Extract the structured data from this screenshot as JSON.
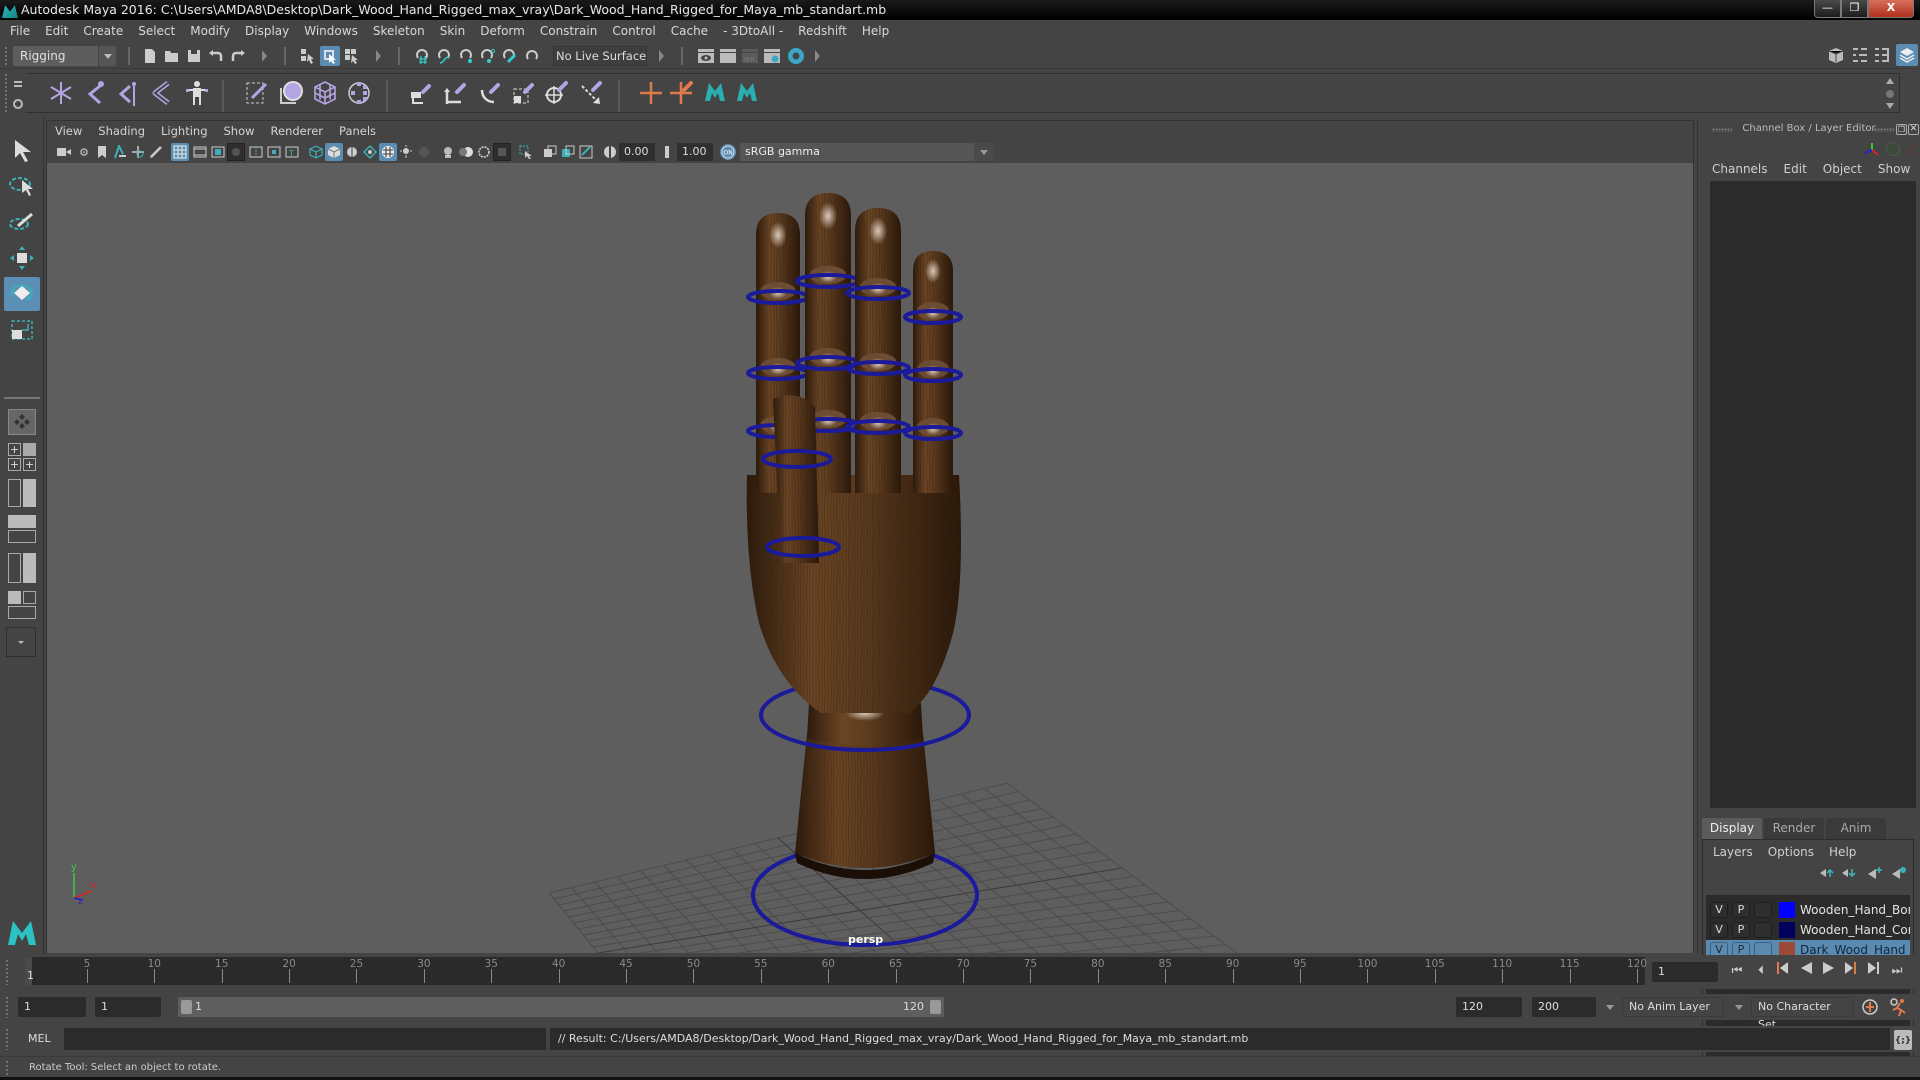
{
  "window": {
    "title": "Autodesk Maya 2016: C:\\Users\\AMDA8\\Desktop\\Dark_Wood_Hand_Rigged_max_vray\\Dark_Wood_Hand_Rigged_for_Maya_mb_standart.mb",
    "minimize": "—",
    "restore": "❐",
    "close": "X"
  },
  "menubar": [
    "File",
    "Edit",
    "Create",
    "Select",
    "Modify",
    "Display",
    "Windows",
    "Skeleton",
    "Skin",
    "Deform",
    "Constrain",
    "Control",
    "Cache",
    "- 3DtoAll -",
    "Redshift",
    "Help"
  ],
  "statusline": {
    "mode": "Rigging",
    "live_surface": "No Live Surface",
    "icons": [
      "new-scene-icon",
      "open-scene-icon",
      "save-scene-icon",
      "undo-icon",
      "redo-icon",
      "select-hierarchy-icon",
      "select-object-icon",
      "select-component-icon",
      "snap-grid-icon",
      "snap-curve-icon",
      "snap-point-icon",
      "snap-view-plane-icon",
      "snap-live-icon",
      "snap-rotate-icon",
      "render-view-icon",
      "render-current-icon",
      "ipr-render-icon",
      "render-settings-icon",
      "hypershade-icon"
    ]
  },
  "shelf": {
    "icons": [
      "create-joints-icon",
      "insert-joint-icon",
      "mirror-joint-icon",
      "ik-handle-icon",
      "humanik-icon",
      "bind-skin-icon",
      "smooth-bind-icon",
      "lattice-icon",
      "cluster-icon",
      "parent-constraint-icon",
      "point-constraint-icon",
      "orient-constraint-icon",
      "scale-constraint-icon",
      "aim-constraint-icon",
      "pole-vector-icon",
      "locator-icon",
      "locator-constraint-icon",
      "maya-logo-icon",
      "maya-logo-icon-2"
    ]
  },
  "toolbox": {
    "tools": [
      "select-tool",
      "lasso-tool",
      "paint-select-tool",
      "move-tool",
      "rotate-tool",
      "scale-tool"
    ],
    "active_tool": "rotate-tool"
  },
  "viewport": {
    "menu": [
      "View",
      "Shading",
      "Lighting",
      "Show",
      "Renderer",
      "Panels"
    ],
    "exposure": "0.00",
    "gamma": "1.00",
    "color_space": "sRGB gamma",
    "color_mgmt_label": "ON",
    "camera_label": "persp",
    "axis": {
      "x": "x",
      "y": "y",
      "z": "z"
    }
  },
  "channel_box": {
    "title": "Channel Box / Layer Editor",
    "menu": [
      "Channels",
      "Edit",
      "Object",
      "Show"
    ]
  },
  "layer_editor": {
    "tabs": [
      "Display",
      "Render",
      "Anim"
    ],
    "active_tab": "Display",
    "menu": [
      "Layers",
      "Options",
      "Help"
    ],
    "layers": [
      {
        "v": "V",
        "p": "P",
        "color": "#0000ff",
        "name": "Wooden_Hand_Bones",
        "selected": false
      },
      {
        "v": "V",
        "p": "P",
        "color": "#00005e",
        "name": "Wooden_Hand_Controllers",
        "selected": false
      },
      {
        "v": "V",
        "p": "P",
        "color": "#9c4a38",
        "name": "Dark_Wood_Hand_Rigged",
        "selected": true
      }
    ]
  },
  "timeline": {
    "ticks": [
      5,
      10,
      15,
      20,
      25,
      30,
      35,
      40,
      45,
      50,
      55,
      60,
      65,
      70,
      75,
      80,
      85,
      90,
      95,
      100,
      105,
      110,
      115,
      120
    ],
    "current_frame": "1",
    "current_frame_field": "1",
    "min_frame": 1,
    "max_frame": 120
  },
  "range": {
    "start_field": "1",
    "playback_start_field": "1",
    "range_start_label": "1",
    "range_end_label": "120",
    "playback_end_field": "120",
    "end_field": "200",
    "anim_layer": "No Anim Layer",
    "character_set": "No Character Set"
  },
  "playback": [
    "go-to-start-icon",
    "step-back-frame-icon",
    "step-back-key-icon",
    "play-backwards-icon",
    "play-forwards-icon",
    "step-forward-key-icon",
    "step-forward-frame-icon",
    "go-to-end-icon"
  ],
  "commandline": {
    "label": "MEL",
    "input_value": "",
    "result": "// Result: C:/Users/AMDA8/Desktop/Dark_Wood_Hand_Rigged_max_vray/Dark_Wood_Hand_Rigged_for_Maya_mb_standart.mb",
    "script_editor_icon": "{;}"
  },
  "helpline": {
    "text": "Rotate Tool: Select an object to rotate."
  },
  "colors": {
    "accent": "#5b8db3",
    "controller_blue": "#1a1aa0",
    "wood": "#5a3a1e",
    "background": "#444444",
    "viewport_bg": "#5e5e5e"
  }
}
